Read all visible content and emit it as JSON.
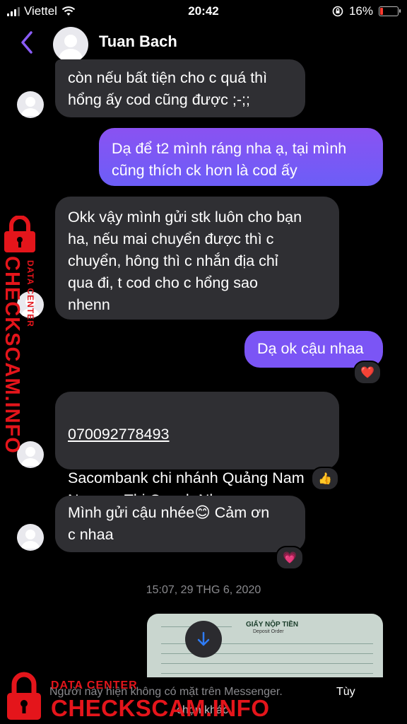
{
  "status_bar": {
    "carrier": "Viettel",
    "time": "20:42",
    "battery": "16%"
  },
  "header": {
    "contact_name": "Tuan Bach"
  },
  "messages": [
    {
      "from": "in",
      "text": "còn nếu bất tiện cho c quá thì\nhổng ấy cod cũng được ;-;;"
    },
    {
      "from": "out",
      "text": "Dạ để t2 mình ráng nha ạ, tại mình\ncũng thích ck hơn là cod ấy"
    },
    {
      "from": "in",
      "text": "Okk vậy mình gửi stk luôn cho bạn\nha, nếu mai chuyển được thì c\nchuyển, hông thì c nhắn địa chỉ\nqua đi, t cod cho c hổng sao\nnhenn"
    },
    {
      "from": "out",
      "text": "Dạ ok cậu nhaa",
      "reaction": "❤️"
    },
    {
      "from": "in",
      "account": "070092778493",
      "text": "Sacombank chi nhánh Quảng Nam\nNguyen Thi Quynh Nhu",
      "reaction": "👍"
    },
    {
      "from": "in",
      "text": "Mình gửi cậu nhée😊 Cảm ơn\nc nhaa",
      "reaction": "💗"
    }
  ],
  "timestamp": "15:07, 29 THG 6, 2020",
  "image_preview": {
    "title": "GIẤY NỘP TIỀN",
    "subtitle": "Deposit Order"
  },
  "footer": {
    "notice": "Người này hiện không có mặt trên Messenger.",
    "action": "Tùy",
    "secondary": "chọn khác"
  },
  "watermark": {
    "main": "CHECKSCAM.INFO",
    "sub": "DATA CENTER"
  },
  "colors": {
    "outgoing": "#7b55f5",
    "incoming": "#2f2f33",
    "accent": "#8a5cf6",
    "watermark": "#e4151b"
  },
  "icons": [
    "wifi-icon",
    "signal-icon",
    "lock-rotation-icon",
    "battery-icon",
    "back-chevron-icon",
    "avatar-icon",
    "scroll-down-icon",
    "lock-icon"
  ]
}
